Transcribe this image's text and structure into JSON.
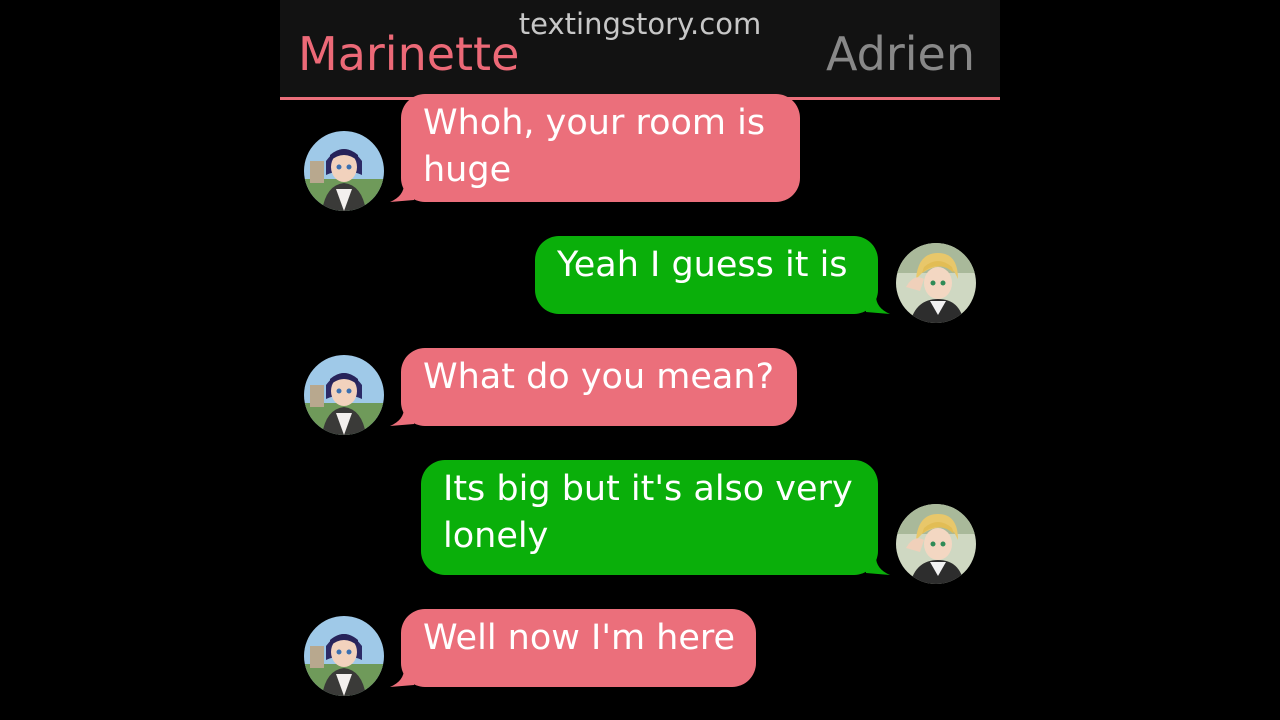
{
  "app": {
    "watermark": "textingstory.com"
  },
  "header": {
    "left_name": "Marinette",
    "right_name": "Adrien"
  },
  "colors": {
    "accent_pink": "#eb6f7b",
    "bubble_green": "#0aaf0a",
    "header_bg": "#121212",
    "background": "#000000"
  },
  "messages": [
    {
      "sender": "Marinette",
      "side": "left",
      "line1": "Whoh, your room is",
      "line2": "huge"
    },
    {
      "sender": "Adrien",
      "side": "right",
      "line1": "Yeah I guess it is",
      "line2": ""
    },
    {
      "sender": "Marinette",
      "side": "left",
      "line1": "What do you mean?",
      "line2": ""
    },
    {
      "sender": "Adrien",
      "side": "right",
      "line1": "Its big but it's also very",
      "line2": "lonely"
    },
    {
      "sender": "Marinette",
      "side": "left",
      "line1": "Well now I'm here",
      "line2": ""
    }
  ],
  "avatars": {
    "left": "marinette-avatar",
    "right": "adrien-avatar"
  }
}
